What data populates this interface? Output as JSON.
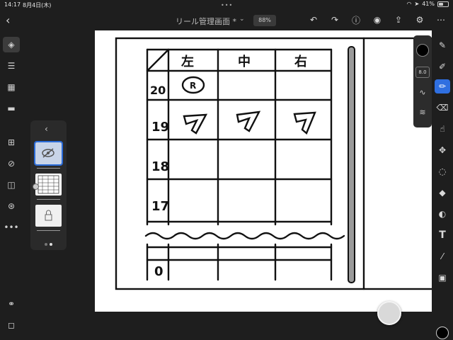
{
  "status_bar": {
    "time": "14:17",
    "date": "8月4日(木)",
    "battery": "41%",
    "battery_level": 0.41
  },
  "header": {
    "title": "リール管理画面 *",
    "zoom": "88%"
  },
  "brush_panel": {
    "size": "8.0",
    "color": "#000000"
  },
  "sheet": {
    "columns": [
      "左",
      "中",
      "右"
    ],
    "rows": [
      {
        "label": "20",
        "cells": [
          "Ⓡ",
          "",
          ""
        ]
      },
      {
        "label": "19",
        "cells": [
          "7",
          "7",
          "7"
        ]
      },
      {
        "label": "18",
        "cells": [
          "",
          "",
          ""
        ]
      },
      {
        "label": "17",
        "cells": [
          "",
          "",
          ""
        ]
      },
      {
        "label": "0",
        "cells": [
          "",
          "",
          ""
        ]
      }
    ]
  },
  "colors": {
    "accent": "#2f6fe0",
    "background": "#1e1e1e",
    "panel": "#2a2a2a"
  }
}
